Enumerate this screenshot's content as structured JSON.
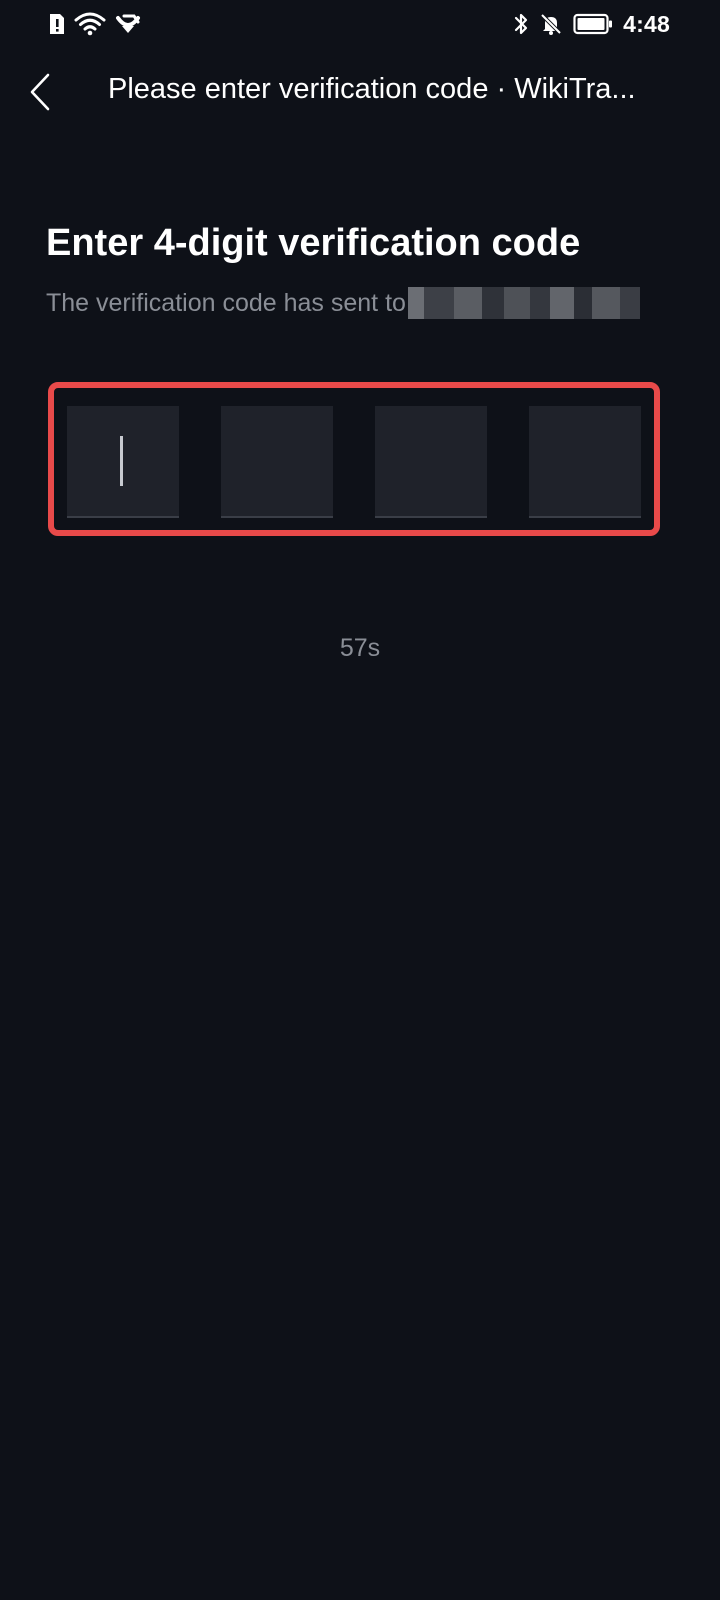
{
  "status_bar": {
    "time": "4:48",
    "left_icons": [
      "sim-alert-icon",
      "wifi-icon",
      "hotspot-icon"
    ],
    "right_icons": [
      "bluetooth-icon",
      "notifications-off-icon",
      "battery-icon"
    ]
  },
  "nav": {
    "back_icon": "chevron-left-icon",
    "title": "Please enter verification code · WikiTra..."
  },
  "verification": {
    "title": "Enter 4-digit verification code",
    "sent_to_label": "The verification code has sent to",
    "recipient_redacted": true,
    "code_digits": [
      "",
      "",
      "",
      ""
    ],
    "active_index": 0,
    "highlight_color": "#e84a4a",
    "countdown": "57s"
  },
  "colors": {
    "background": "#0e1118",
    "input_box": "#1f222a",
    "muted_text": "#8a8e96"
  }
}
